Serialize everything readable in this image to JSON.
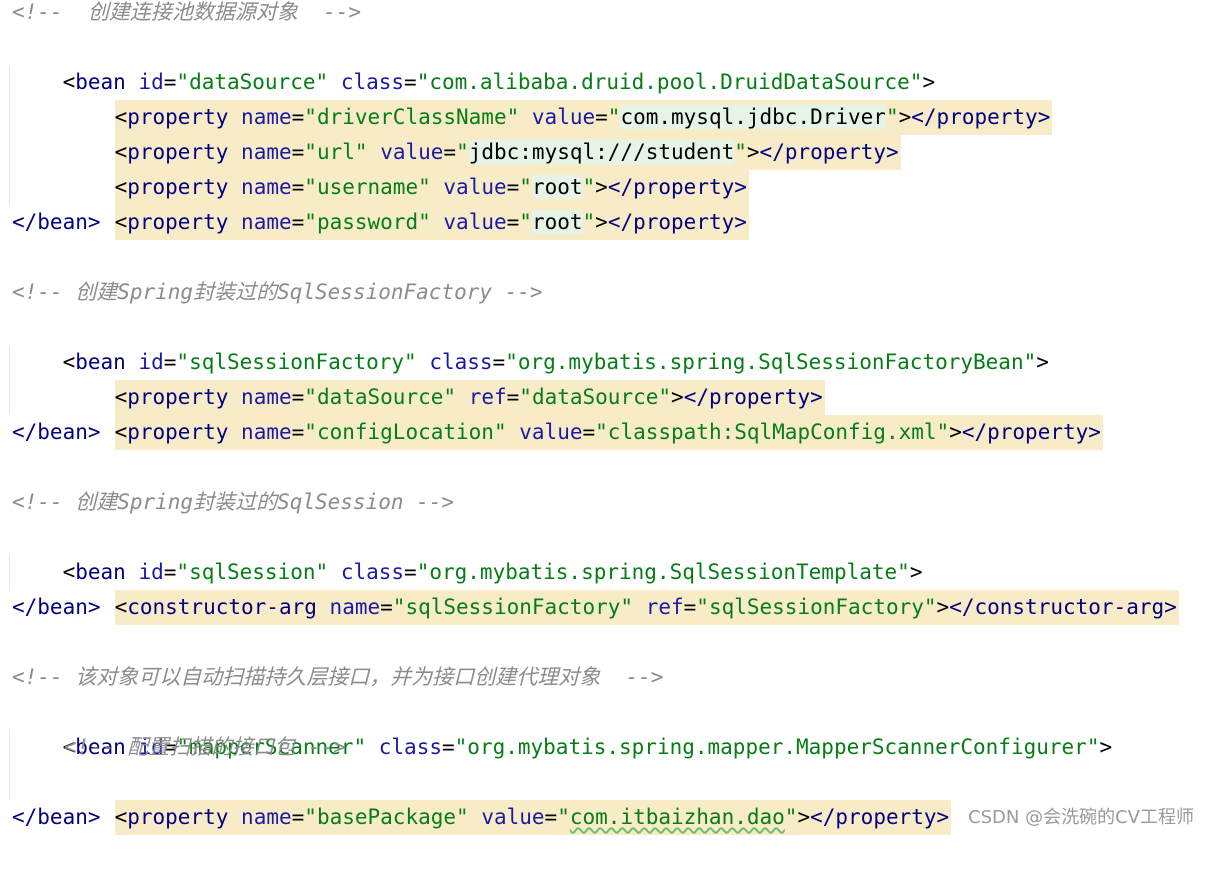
{
  "editor": {
    "lines": [
      {
        "type": "comment",
        "text": "<!--  创建连接池数据源对象  -->"
      },
      {
        "type": "open",
        "tag": "bean",
        "attrs": [
          [
            "id",
            "dataSource"
          ],
          [
            "class",
            "com.alibaba.druid.pool.DruidDataSource"
          ]
        ]
      },
      {
        "type": "prop",
        "tag": "property",
        "attrs": [
          [
            "name",
            "driverClassName"
          ],
          [
            "value",
            "com.mysql.jdbc.Driver"
          ]
        ],
        "close": "</property>"
      },
      {
        "type": "prop",
        "tag": "property",
        "attrs": [
          [
            "name",
            "url"
          ],
          [
            "value",
            "jdbc:mysql:///student"
          ]
        ],
        "close": "</property>"
      },
      {
        "type": "prop",
        "tag": "property",
        "attrs": [
          [
            "name",
            "username"
          ],
          [
            "value",
            "root"
          ]
        ],
        "close": "</property>"
      },
      {
        "type": "prop",
        "tag": "property",
        "attrs": [
          [
            "name",
            "password"
          ],
          [
            "value",
            "root"
          ]
        ],
        "close": "</property>"
      },
      {
        "type": "close",
        "text": "</bean>"
      },
      {
        "type": "comment",
        "text": "<!-- 创建Spring封装过的SqlSessionFactory -->"
      },
      {
        "type": "open",
        "tag": "bean",
        "attrs": [
          [
            "id",
            "sqlSessionFactory"
          ],
          [
            "class",
            "org.mybatis.spring.SqlSessionFactoryBean"
          ]
        ]
      },
      {
        "type": "prop",
        "tag": "property",
        "attrs": [
          [
            "name",
            "dataSource"
          ],
          [
            "ref",
            "dataSource"
          ]
        ],
        "close": "</property>"
      },
      {
        "type": "prop",
        "tag": "property",
        "attrs": [
          [
            "name",
            "configLocation"
          ],
          [
            "value",
            "classpath:SqlMapConfig.xml"
          ]
        ],
        "close": "</property>"
      },
      {
        "type": "close",
        "text": "</bean>"
      },
      {
        "type": "comment",
        "text": "<!-- 创建Spring封装过的SqlSession -->"
      },
      {
        "type": "open",
        "tag": "bean",
        "attrs": [
          [
            "id",
            "sqlSession"
          ],
          [
            "class",
            "org.mybatis.spring.SqlSessionTemplate"
          ]
        ]
      },
      {
        "type": "prop",
        "tag": "constructor-arg",
        "attrs": [
          [
            "name",
            "sqlSessionFactory"
          ],
          [
            "ref",
            "sqlSessionFactory"
          ]
        ],
        "close": "</constructor-arg>"
      },
      {
        "type": "close",
        "text": "</bean>"
      },
      {
        "type": "comment",
        "text": "<!-- 该对象可以自动扫描持久层接口，并为接口创建代理对象  -->"
      },
      {
        "type": "open",
        "tag": "bean",
        "attrs": [
          [
            "id",
            "mapperScanner"
          ],
          [
            "class",
            "org.mybatis.spring.mapper.MapperScannerConfigurer"
          ]
        ]
      },
      {
        "type": "comment-indent",
        "text": "<!-- 配置扫描的接口包 -->"
      },
      {
        "type": "prop",
        "tag": "property",
        "attrs": [
          [
            "name",
            "basePackage"
          ],
          [
            "value",
            "com.itbaizhan.dao"
          ]
        ],
        "close": "</property>"
      },
      {
        "type": "close",
        "text": "</bean>"
      }
    ]
  },
  "watermark": "CSDN @会洗碗的CV工程师",
  "colors": {
    "tag": "#000080",
    "attribute": "#1a1aa6",
    "string": "#067d17",
    "comment": "#8c8c8c",
    "line_highlight": "#f8ecc8"
  }
}
